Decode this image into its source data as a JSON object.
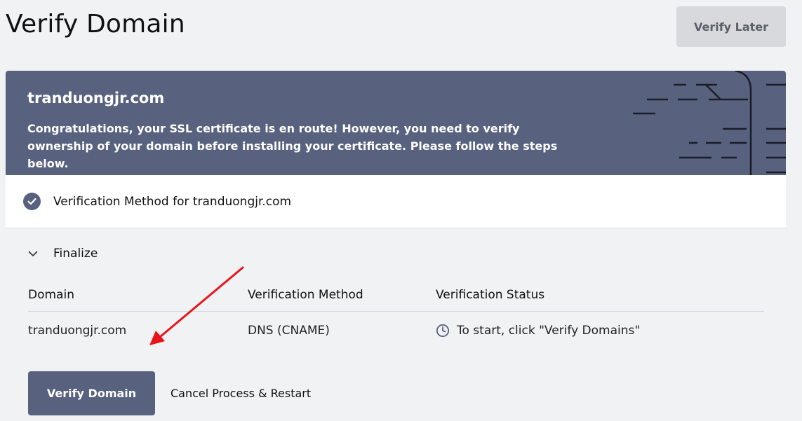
{
  "page": {
    "title": "Verify Domain",
    "verify_later_label": "Verify Later"
  },
  "banner": {
    "domain": "tranduongjr.com",
    "message": "Congratulations, your SSL certificate is en route! However, you need to verify ownership of your domain before installing your certificate. Please follow the steps below."
  },
  "method_step": {
    "label": "Verification Method for tranduongjr.com",
    "icon": "check-circle-icon"
  },
  "finalize": {
    "label": "Finalize",
    "icon": "chevron-down-icon",
    "table": {
      "headers": [
        "Domain",
        "Verification Method",
        "Verification Status"
      ],
      "rows": [
        {
          "domain": "tranduongjr.com",
          "method": "DNS (CNAME)",
          "status": "To start, click \"Verify Domains\"",
          "status_icon": "clock-icon"
        }
      ]
    },
    "verify_button_label": "Verify Domain",
    "cancel_button_label": "Cancel Process & Restart"
  },
  "colors": {
    "banner_bg": "#58627f",
    "page_bg": "#f1f2f4",
    "secondary_button_bg": "#d7d9dd",
    "annotation_arrow": "#e8141c"
  }
}
